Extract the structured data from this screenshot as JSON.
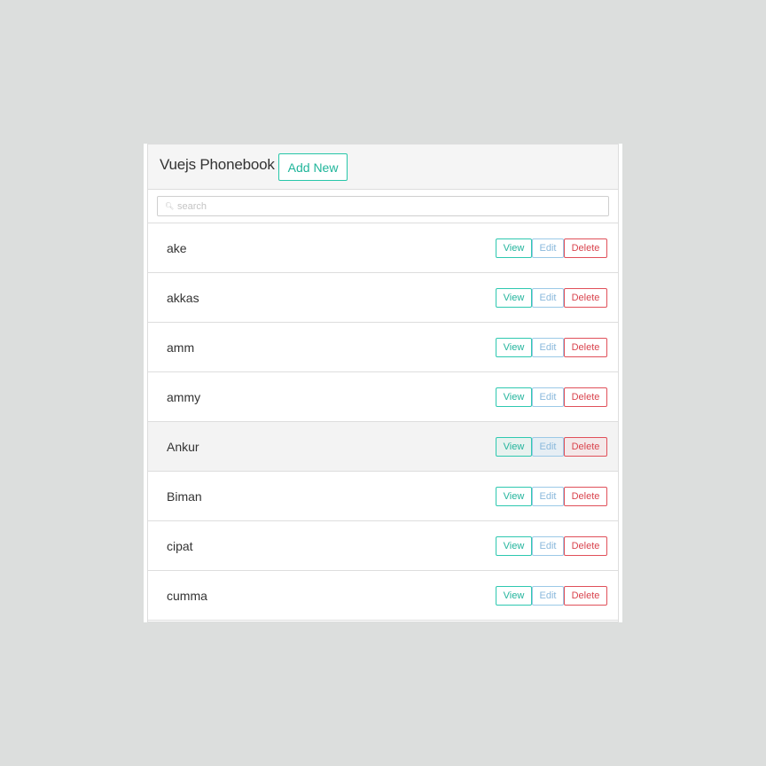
{
  "header": {
    "title": "Vuejs Phonebook",
    "add_new_label": "Add New"
  },
  "search": {
    "icon": "search-icon",
    "placeholder": "search",
    "value": ""
  },
  "actions": {
    "view_label": "View",
    "edit_label": "Edit",
    "delete_label": "Delete"
  },
  "colors": {
    "view": "#22b49c",
    "edit": "#8ab9dc",
    "delete": "#d9434d",
    "add_new": "#1fb59a"
  },
  "contacts": [
    {
      "name": "ake"
    },
    {
      "name": "akkas"
    },
    {
      "name": "amm"
    },
    {
      "name": "ammy"
    },
    {
      "name": "Ankur",
      "hovered": true
    },
    {
      "name": "Biman"
    },
    {
      "name": "cipat"
    },
    {
      "name": "cumma"
    }
  ]
}
